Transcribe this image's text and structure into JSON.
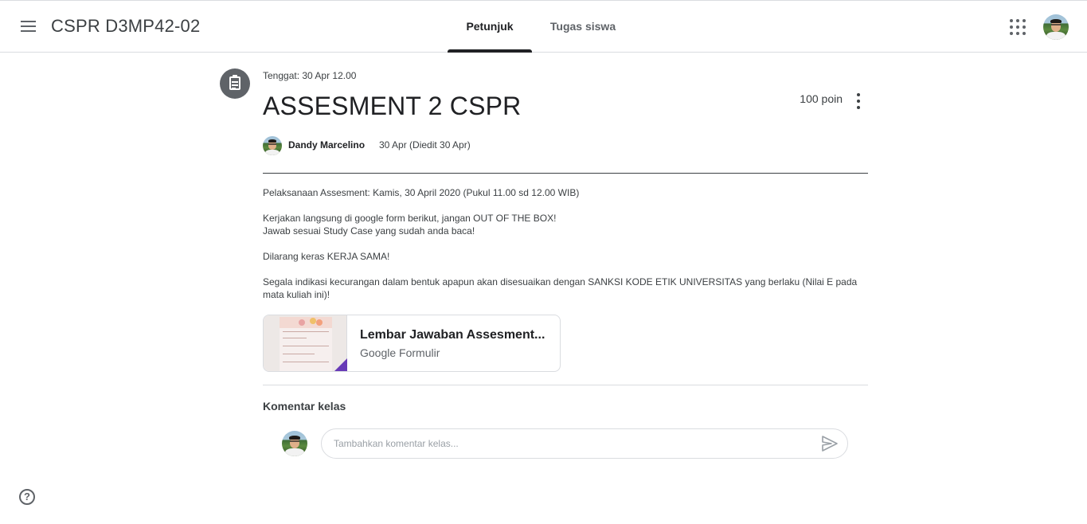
{
  "header": {
    "class_title": "CSPR D3MP42-02",
    "menu_icon": "hamburger-menu-icon",
    "tabs": [
      {
        "label": "Petunjuk",
        "active": true
      },
      {
        "label": "Tugas siswa",
        "active": false
      }
    ],
    "apps_icon": "apps-grid-icon",
    "user_avatar": "user-avatar"
  },
  "assignment": {
    "icon": "assignment-clipboard-icon",
    "due": "Tenggat: 30 Apr 12.00",
    "title": "ASSESMENT 2 CSPR",
    "points": "100 poin",
    "author": "Dandy Marcelino",
    "posted": "30 Apr (Diedit 30 Apr)",
    "body": [
      "Pelaksanaan Assesment: Kamis, 30 April 2020 (Pukul 11.00 sd 12.00 WIB)",
      "Kerjakan langsung di google form berikut, jangan OUT OF THE BOX!\nJawab sesuai Study Case yang sudah anda baca!",
      "Dilarang keras KERJA SAMA!",
      "Segala indikasi kecurangan dalam bentuk apapun akan disesuaikan dengan SANKSI KODE ETIK UNIVERSITAS yang berlaku (Nilai E pada mata kuliah ini)!"
    ],
    "attachment": {
      "title": "Lembar Jawaban Assesment...",
      "type": "Google Formulir",
      "accent_color": "#673ab7"
    }
  },
  "comments": {
    "heading": "Komentar kelas",
    "placeholder": "Tambahkan komentar kelas...",
    "send_icon": "send-icon"
  },
  "footer": {
    "help_label": "?"
  },
  "colors": {
    "text_primary": "#202124",
    "text_secondary": "#5f6368",
    "divider": "#dadce0"
  }
}
